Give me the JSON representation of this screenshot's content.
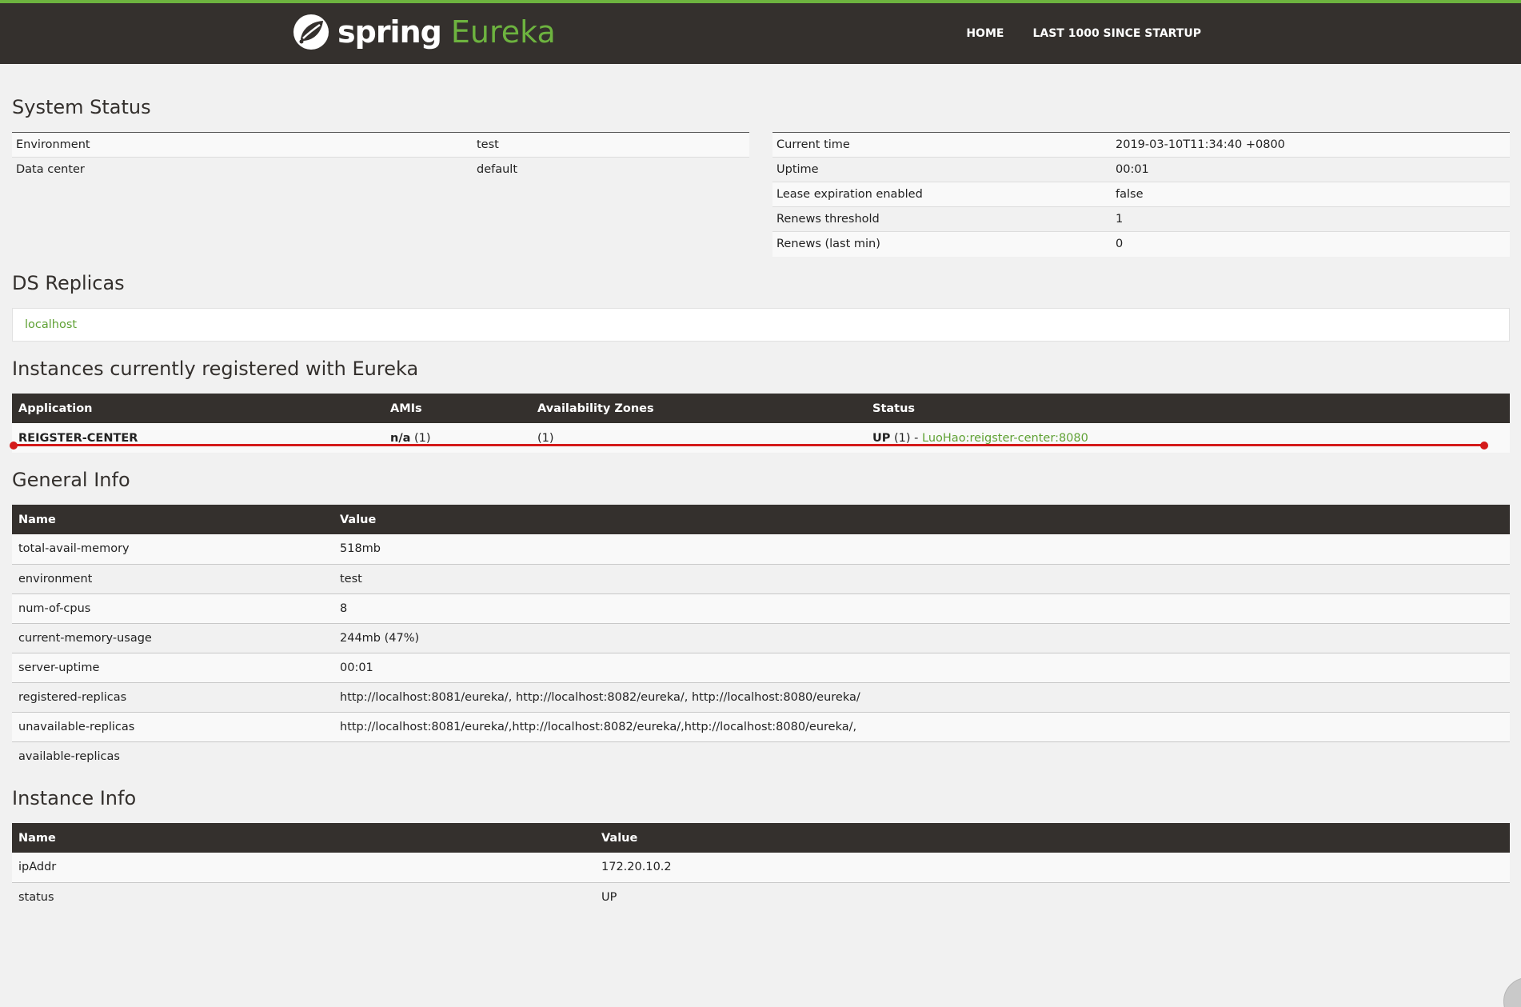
{
  "header": {
    "brand_spring": "spring",
    "brand_eureka": "Eureka",
    "nav": [
      {
        "label": "HOME"
      },
      {
        "label": "LAST 1000 SINCE STARTUP"
      }
    ],
    "accent_color": "#6db33f",
    "bar_color": "#34302d"
  },
  "system_status": {
    "title": "System Status",
    "left": [
      {
        "key": "Environment",
        "value": "test"
      },
      {
        "key": "Data center",
        "value": "default"
      }
    ],
    "right": [
      {
        "key": "Current time",
        "value": "2019-03-10T11:34:40 +0800"
      },
      {
        "key": "Uptime",
        "value": "00:01"
      },
      {
        "key": "Lease expiration enabled",
        "value": "false"
      },
      {
        "key": "Renews threshold",
        "value": "1"
      },
      {
        "key": "Renews (last min)",
        "value": "0"
      }
    ]
  },
  "ds_replicas": {
    "title": "DS Replicas",
    "items": [
      "localhost"
    ]
  },
  "instances": {
    "title": "Instances currently registered with Eureka",
    "headers": [
      "Application",
      "AMIs",
      "Availability Zones",
      "Status"
    ],
    "rows": [
      {
        "application": "REIGSTER-CENTER",
        "amis_bold": "n/a",
        "amis_count": "(1)",
        "zones": "(1)",
        "status_bold": "UP",
        "status_count": "(1) -",
        "status_link": "LuoHao:reigster-center:8080"
      }
    ]
  },
  "general_info": {
    "title": "General Info",
    "headers": [
      "Name",
      "Value"
    ],
    "rows": [
      {
        "name": "total-avail-memory",
        "value": "518mb"
      },
      {
        "name": "environment",
        "value": "test"
      },
      {
        "name": "num-of-cpus",
        "value": "8"
      },
      {
        "name": "current-memory-usage",
        "value": "244mb (47%)"
      },
      {
        "name": "server-uptime",
        "value": "00:01"
      },
      {
        "name": "registered-replicas",
        "value": "http://localhost:8081/eureka/, http://localhost:8082/eureka/, http://localhost:8080/eureka/"
      },
      {
        "name": "unavailable-replicas",
        "value": "http://localhost:8081/eureka/,http://localhost:8082/eureka/,http://localhost:8080/eureka/,"
      },
      {
        "name": "available-replicas",
        "value": ""
      }
    ]
  },
  "instance_info": {
    "title": "Instance Info",
    "headers": [
      "Name",
      "Value"
    ],
    "rows": [
      {
        "name": "ipAddr",
        "value": "172.20.10.2"
      },
      {
        "name": "status",
        "value": "UP"
      }
    ]
  }
}
